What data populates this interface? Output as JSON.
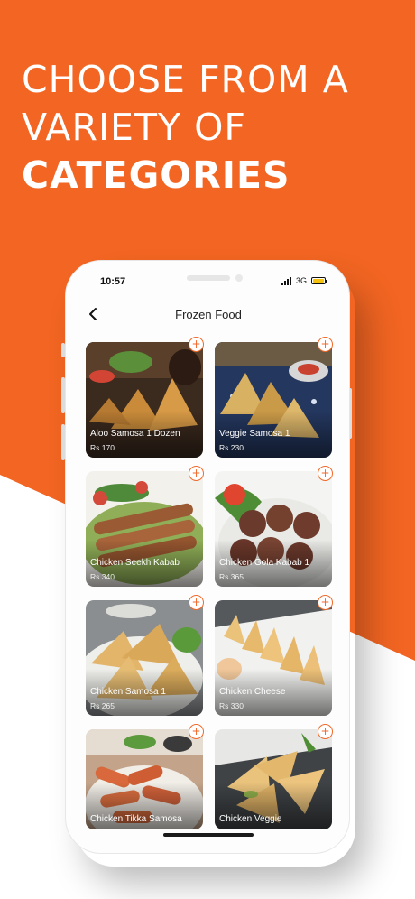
{
  "headline": {
    "line1": "CHOOSE FROM A",
    "line2": "VARIETY OF",
    "line3": "CATEGORIES"
  },
  "colors": {
    "brand_orange": "#f26522",
    "plus_accent": "#f26a2a",
    "battery": "#f4c10f"
  },
  "status_bar": {
    "time": "10:57",
    "network": "3G"
  },
  "nav": {
    "title": "Frozen Food",
    "back_icon": "chevron-left-icon"
  },
  "products": [
    {
      "name": "Aloo Samosa 1 Dozen",
      "price": "Rs 170"
    },
    {
      "name": "Veggie Samosa 1",
      "price": "Rs 230"
    },
    {
      "name": "Chicken Seekh Kabab",
      "price": "Rs 340"
    },
    {
      "name": "Chicken Gola Kabab 1",
      "price": "Rs 365"
    },
    {
      "name": "Chicken Samosa 1",
      "price": "Rs 265"
    },
    {
      "name": "Chicken Cheese",
      "price": "Rs 330"
    },
    {
      "name": "Chicken Tikka Samosa",
      "price": ""
    },
    {
      "name": "Chicken Veggie",
      "price": ""
    }
  ]
}
